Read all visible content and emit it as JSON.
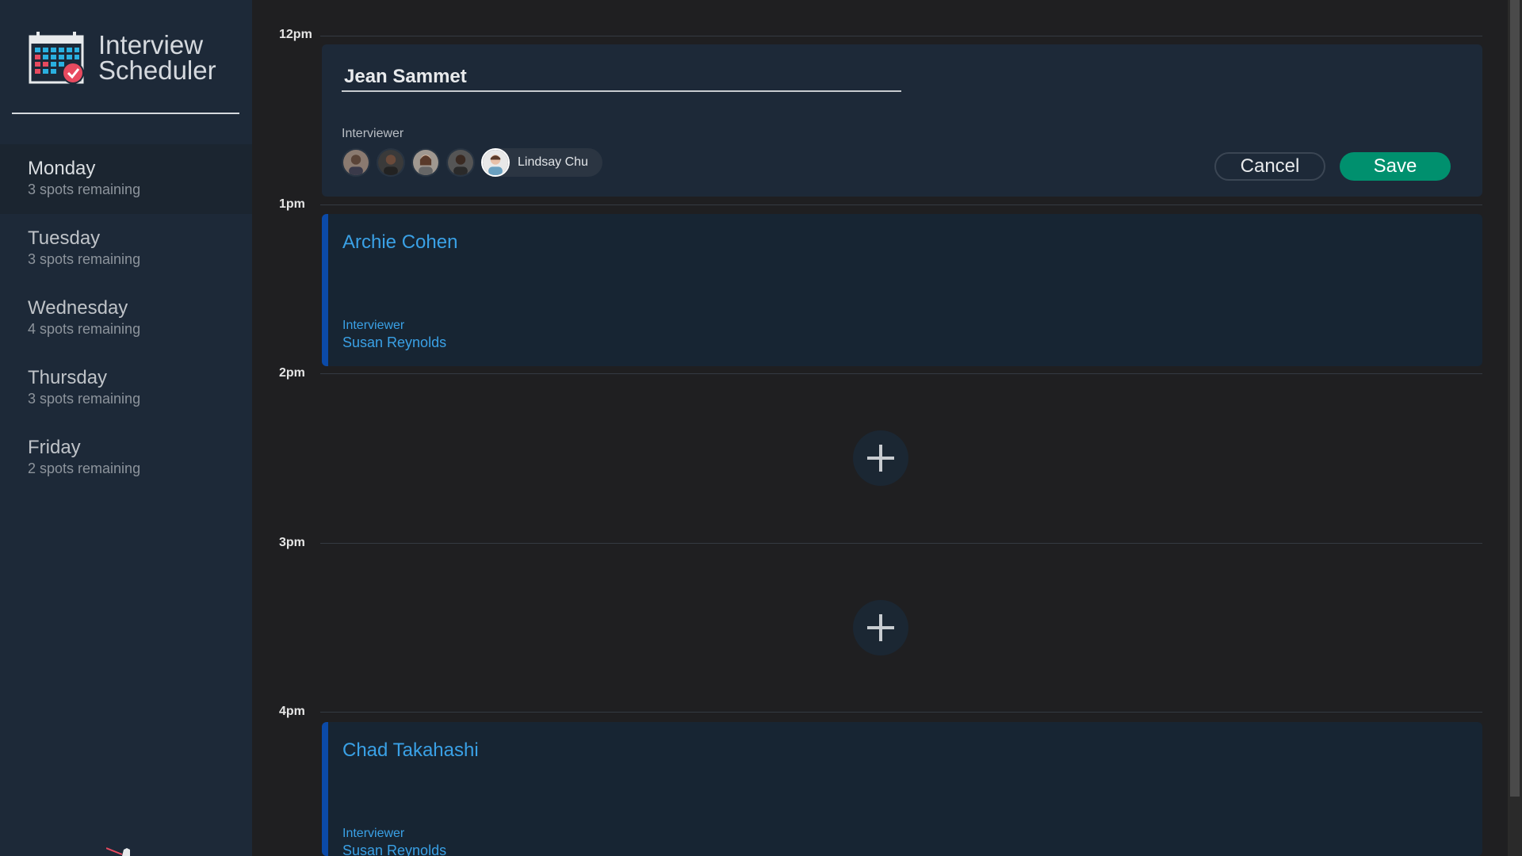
{
  "app": {
    "title_line1": "Interview",
    "title_line2": "Scheduler"
  },
  "sidebar": {
    "days": [
      {
        "name": "Monday",
        "spots": "3 spots remaining",
        "selected": true
      },
      {
        "name": "Tuesday",
        "spots": "3 spots remaining",
        "selected": false
      },
      {
        "name": "Wednesday",
        "spots": "4 spots remaining",
        "selected": false
      },
      {
        "name": "Thursday",
        "spots": "3 spots remaining",
        "selected": false
      },
      {
        "name": "Friday",
        "spots": "2 spots remaining",
        "selected": false
      }
    ]
  },
  "schedule": {
    "hours": [
      "12pm",
      "1pm",
      "2pm",
      "3pm",
      "4pm"
    ],
    "form": {
      "student_value": "Jean Sammet",
      "interviewer_label": "Interviewer",
      "selected_interviewer": "Lindsay Chu",
      "cancel_label": "Cancel",
      "save_label": "Save"
    },
    "appointments": [
      {
        "student": "Archie Cohen",
        "interviewer_label": "Interviewer",
        "interviewer": "Susan Reynolds"
      },
      {
        "student": "Chad Takahashi",
        "interviewer_label": "Interviewer",
        "interviewer": "Susan Reynolds"
      }
    ]
  },
  "icons": {
    "add": "plus-icon",
    "logo": "calendar-check-icon"
  },
  "colors": {
    "accent_blue": "#3aa1e6",
    "save_green": "#00906e",
    "booked_border": "#0b4aa8"
  }
}
